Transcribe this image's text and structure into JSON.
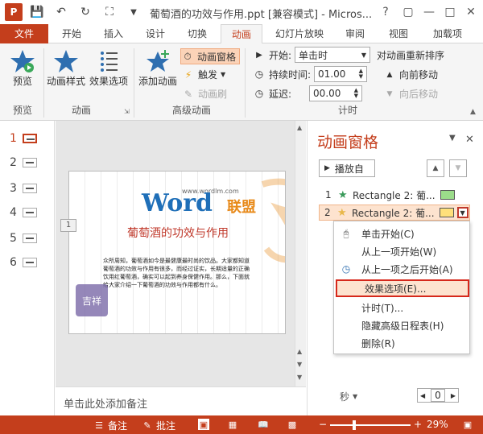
{
  "window": {
    "title": "葡萄酒的功效与作用.ppt [兼容模式] - Micros...",
    "app_icon_letter": "P",
    "help": "?"
  },
  "tabs": [
    {
      "label": "文件"
    },
    {
      "label": "开始"
    },
    {
      "label": "插入"
    },
    {
      "label": "设计"
    },
    {
      "label": "切换"
    },
    {
      "label": "动画"
    },
    {
      "label": "幻灯片放映"
    },
    {
      "label": "审阅"
    },
    {
      "label": "视图"
    },
    {
      "label": "加载项"
    }
  ],
  "ribbon": {
    "preview": {
      "label": "预览",
      "group": "预览"
    },
    "anim_style": "动画样式",
    "effect_options": "效果选项",
    "anim_group": "动画",
    "add_anim": "添加动画",
    "anim_pane": "动画窗格",
    "trigger": "触发",
    "anim_brush": "动画刷",
    "adv_group": "高级动画",
    "start_label": "开始:",
    "start_value": "单击时",
    "duration_label": "持续时间:",
    "duration_value": "01.00",
    "delay_label": "延迟:",
    "delay_value": "00.00",
    "reorder_title": "对动画重新排序",
    "move_earlier": "向前移动",
    "move_later": "向后移动",
    "timing_group": "计时"
  },
  "thumbnails": [
    "1",
    "2",
    "3",
    "4",
    "5",
    "6"
  ],
  "slide": {
    "title": "葡萄酒的功效与作用",
    "body": "众所周知，葡萄酒如今是最健康最时尚的饮品。大家都知道葡萄酒的功效与作用有很多，而经过证实，长期适量的正确饮用红葡萄酒，确实可以起到养身保健作用。那么，下面就给大家介绍一下葡萄酒的功效与作用都有什么。",
    "anim_tag": "1",
    "logo_word": "Word",
    "logo_cn": "联盟",
    "logo_url": "www.wordlm.com",
    "stamp_text": "吉祥"
  },
  "notes": "单击此处添加备注",
  "pane": {
    "title": "动画窗格",
    "play_from": "播放自",
    "items": [
      {
        "num": "1",
        "label": "Rectangle 2: 葡...",
        "star_color": "#3a9a5a",
        "bar_color": "#9bdc8a"
      },
      {
        "num": "2",
        "label": "Rectangle 2: 葡...",
        "star_color": "#e8b84a",
        "bar_color": "#ffe07a"
      }
    ],
    "menu": [
      {
        "icon": "mouse-icon",
        "label": "单击开始(C)"
      },
      {
        "icon": "",
        "label": "从上一项开始(W)"
      },
      {
        "icon": "clock-icon",
        "label": "从上一项之后开始(A)"
      },
      {
        "icon": "",
        "label": "效果选项(E)..."
      },
      {
        "icon": "",
        "label": "计时(T)..."
      },
      {
        "icon": "",
        "label": "隐藏高级日程表(H)"
      },
      {
        "icon": "",
        "label": "删除(R)"
      }
    ],
    "seconds_label": "秒",
    "zoom_value": "0"
  },
  "status": {
    "notes": "备注",
    "comments": "批注",
    "zoom": "29%"
  },
  "colors": {
    "accent": "#c43e1c",
    "highlight": "#fde3cf",
    "menu_highlight_border": "#d6281b"
  }
}
